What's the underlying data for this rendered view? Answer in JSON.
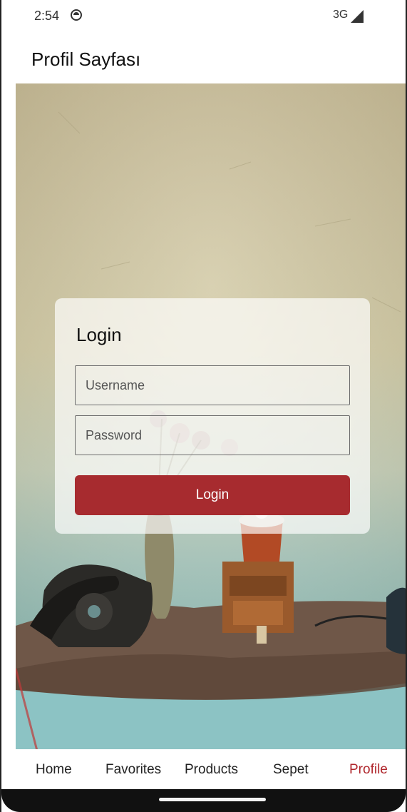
{
  "status_bar": {
    "time": "2:54",
    "network": "3G"
  },
  "app_bar": {
    "title": "Profil Sayfası"
  },
  "login": {
    "title": "Login",
    "username_placeholder": "Username",
    "password_placeholder": "Password",
    "button_label": "Login"
  },
  "bottom_nav": {
    "items": [
      {
        "label": "Home"
      },
      {
        "label": "Favorites"
      },
      {
        "label": "Products"
      },
      {
        "label": "Sepet"
      },
      {
        "label": "Profile"
      }
    ],
    "active": "Profile"
  },
  "colors": {
    "accent": "#a72b2f",
    "active_nav": "#b0272d"
  }
}
